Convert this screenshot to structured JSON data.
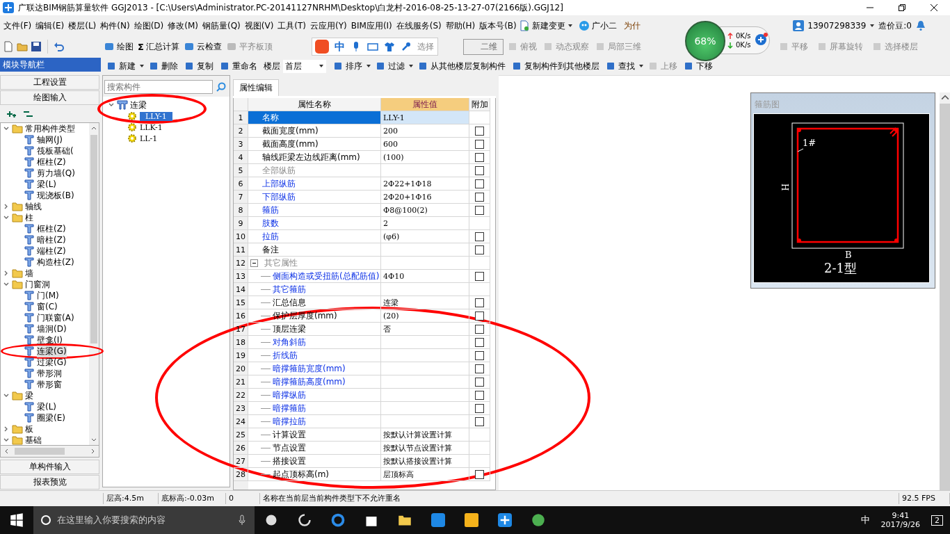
{
  "window": {
    "title": "广联达BIM钢筋算量软件 GGJ2013 - [C:\\Users\\Administrator.PC-20141127NRHM\\Desktop\\白龙村-2016-08-25-13-27-07(2166版).GGJ12]"
  },
  "menu": [
    "文件(F)",
    "编辑(E)",
    "楼层(L)",
    "构件(N)",
    "绘图(D)",
    "修改(M)",
    "钢筋量(Q)",
    "视图(V)",
    "工具(T)",
    "云应用(Y)",
    "BIM应用(I)",
    "在线服务(S)",
    "帮助(H)",
    "版本号(B)"
  ],
  "menu_extras": {
    "change": "新建变更",
    "assistant": "广小二",
    "notice": "为什",
    "account": "13907298339",
    "beans": "造价豆:0"
  },
  "toolbar": [
    {
      "label": "绘图",
      "disabled": false
    },
    {
      "label": "汇总计算",
      "glyph": "Σ",
      "disabled": false
    },
    {
      "label": "云检查",
      "disabled": false
    },
    {
      "label": "平齐板顶",
      "disabled": true
    }
  ],
  "ime": {
    "label": "中",
    "tail": "选择"
  },
  "view_toolbar": [
    {
      "label": "二维",
      "kind": "select"
    },
    {
      "label": "俯视",
      "kind": "button"
    },
    {
      "label": "动态观察",
      "kind": "button"
    },
    {
      "label": "局部三维",
      "kind": "button"
    },
    {
      "label": "平移",
      "kind": "button"
    },
    {
      "label": "屏幕旋转",
      "kind": "button"
    },
    {
      "label": "选择楼层",
      "kind": "button"
    }
  ],
  "net_widget": {
    "percent": "68%",
    "up": "0K/s",
    "down": "0K/s"
  },
  "nav": {
    "title": "模块导航栏",
    "top_buttons": [
      "工程设置",
      "绘图输入"
    ],
    "tree": [
      {
        "label": "常用构件类型",
        "expanded": true,
        "children": [
          {
            "label": "轴网(J)",
            "selected": false
          },
          {
            "label": "筏板基础(",
            "selected": false
          },
          {
            "label": "框柱(Z)",
            "selected": false
          },
          {
            "label": "剪力墙(Q)",
            "selected": false
          },
          {
            "label": "梁(L)",
            "selected": false
          },
          {
            "label": "现浇板(B)",
            "selected": false
          }
        ]
      },
      {
        "label": "轴线",
        "expanded": false
      },
      {
        "label": "柱",
        "expanded": true,
        "children": [
          {
            "label": "框柱(Z)",
            "selected": false
          },
          {
            "label": "暗柱(Z)",
            "selected": false
          },
          {
            "label": "端柱(Z)",
            "selected": false
          },
          {
            "label": "构造柱(Z)",
            "selected": false
          }
        ]
      },
      {
        "label": "墙",
        "expanded": false
      },
      {
        "label": "门窗洞",
        "expanded": true,
        "children": [
          {
            "label": "门(M)",
            "selected": false
          },
          {
            "label": "窗(C)",
            "selected": false
          },
          {
            "label": "门联窗(A)",
            "selected": false
          },
          {
            "label": "墙洞(D)",
            "selected": false
          },
          {
            "label": "壁龛(I)",
            "selected": false
          },
          {
            "label": "连梁(G)",
            "selected": true
          },
          {
            "label": "过梁(G)",
            "selected": false
          },
          {
            "label": "带形洞",
            "selected": false
          },
          {
            "label": "带形窗",
            "selected": false
          }
        ]
      },
      {
        "label": "梁",
        "expanded": true,
        "children": [
          {
            "label": "梁(L)",
            "selected": false
          },
          {
            "label": "圈梁(E)",
            "selected": false
          }
        ]
      },
      {
        "label": "板",
        "expanded": false
      },
      {
        "label": "基础",
        "expanded": true
      }
    ],
    "bottom_buttons": [
      "单构件输入",
      "报表预览"
    ]
  },
  "list_toolbar": [
    {
      "label": "新建",
      "kind": "button",
      "dropdown": true,
      "disabled": false
    },
    {
      "label": "删除",
      "kind": "button",
      "dropdown": false,
      "disabled": false
    },
    {
      "label": "复制",
      "kind": "button",
      "dropdown": false,
      "disabled": false
    },
    {
      "label": "重命名",
      "kind": "button",
      "dropdown": false,
      "disabled": false
    },
    {
      "label": "楼层",
      "kind": "select",
      "value": "首层"
    },
    {
      "label": "排序",
      "kind": "button",
      "dropdown": true,
      "disabled": false
    },
    {
      "label": "过滤",
      "kind": "button",
      "dropdown": true,
      "disabled": false
    },
    {
      "label": "从其他楼层复制构件",
      "kind": "button",
      "dropdown": false,
      "disabled": false
    },
    {
      "label": "复制构件到其他楼层",
      "kind": "button",
      "dropdown": false,
      "disabled": false
    },
    {
      "label": "查找",
      "kind": "button",
      "dropdown": true,
      "disabled": false
    },
    {
      "label": "上移",
      "kind": "button",
      "dropdown": false,
      "disabled": true
    },
    {
      "label": "下移",
      "kind": "button",
      "dropdown": false,
      "disabled": false
    }
  ],
  "component_list": {
    "placeholder": "搜索构件",
    "root": {
      "label": "连梁",
      "expanded": true,
      "children": [
        {
          "label": "LLY-1",
          "selected": true
        },
        {
          "label": "LLK-1",
          "selected": false
        },
        {
          "label": "LL-1",
          "selected": false
        }
      ]
    }
  },
  "properties": {
    "tab": "属性编辑",
    "columns": [
      "属性名称",
      "属性值",
      "附加"
    ],
    "rows": [
      {
        "no": "1",
        "name": "名称",
        "value": "LLY-1",
        "kind": "normal",
        "selected": true
      },
      {
        "no": "2",
        "name": "截面宽度(mm)",
        "value": "200",
        "kind": "normal",
        "selected": false,
        "checked": false
      },
      {
        "no": "3",
        "name": "截面高度(mm)",
        "value": "600",
        "kind": "normal",
        "selected": false,
        "checked": false
      },
      {
        "no": "4",
        "name": "轴线距梁左边线距离(mm)",
        "value": "(100)",
        "kind": "normal",
        "selected": false,
        "checked": false
      },
      {
        "no": "5",
        "name": "全部纵筋",
        "kind": "muted",
        "selected": false,
        "checked": false
      },
      {
        "no": "6",
        "name": "上部纵筋",
        "value": "2Ф22+1Ф18",
        "kind": "link",
        "selected": false,
        "checked": false
      },
      {
        "no": "7",
        "name": "下部纵筋",
        "value": "2Ф20+1Ф16",
        "kind": "link",
        "selected": false,
        "checked": false
      },
      {
        "no": "8",
        "name": "箍筋",
        "value": "Ф8@100(2)",
        "kind": "link",
        "selected": false,
        "checked": false
      },
      {
        "no": "9",
        "name": "肢数",
        "value": "2",
        "kind": "link",
        "selected": false
      },
      {
        "no": "10",
        "name": "拉筋",
        "value": "(φ6)",
        "kind": "link",
        "selected": false,
        "checked": false
      },
      {
        "no": "11",
        "name": "备注",
        "kind": "normal",
        "selected": false,
        "checked": false
      },
      {
        "no": "12",
        "name": "其它属性",
        "kind": "muted",
        "selected": false,
        "expanded": true,
        "children": [
          {
            "no": "13",
            "name": "侧面构造或受扭筋(总配筋值)",
            "value": "4Ф10",
            "kind": "link",
            "selected": false,
            "checked": false
          },
          {
            "no": "14",
            "name": "其它箍筋",
            "kind": "link",
            "selected": false
          },
          {
            "no": "15",
            "name": "汇总信息",
            "value": "连梁",
            "kind": "normal",
            "selected": false,
            "checked": false
          },
          {
            "no": "16",
            "name": "保护层厚度(mm)",
            "value": "(20)",
            "kind": "normal",
            "selected": false,
            "checked": false
          },
          {
            "no": "17",
            "name": "顶层连梁",
            "value": "否",
            "kind": "normal",
            "selected": false,
            "checked": false
          },
          {
            "no": "18",
            "name": "对角斜筋",
            "kind": "link",
            "selected": false,
            "checked": false
          },
          {
            "no": "19",
            "name": "折线筋",
            "kind": "link",
            "selected": false,
            "checked": false
          },
          {
            "no": "20",
            "name": "暗撑箍筋宽度(mm)",
            "kind": "link",
            "selected": false,
            "checked": false
          },
          {
            "no": "21",
            "name": "暗撑箍筋高度(mm)",
            "kind": "link",
            "selected": false,
            "checked": false
          },
          {
            "no": "22",
            "name": "暗撑纵筋",
            "kind": "link",
            "selected": false,
            "checked": false
          },
          {
            "no": "23",
            "name": "暗撑箍筋",
            "kind": "link",
            "selected": false,
            "checked": false
          },
          {
            "no": "24",
            "name": "暗撑拉筋",
            "kind": "link",
            "selected": false,
            "checked": false
          },
          {
            "no": "25",
            "name": "计算设置",
            "value": "按默认计算设置计算",
            "kind": "normal",
            "selected": false
          },
          {
            "no": "26",
            "name": "节点设置",
            "value": "按默认节点设置计算",
            "kind": "normal",
            "selected": false
          },
          {
            "no": "27",
            "name": "搭接设置",
            "value": "按默认搭接设置计算",
            "kind": "normal",
            "selected": false
          },
          {
            "no": "28",
            "name": "起点顶标高(m)",
            "value": "层顶标高",
            "kind": "normal",
            "selected": false,
            "checked": false
          }
        ]
      }
    ]
  },
  "stirrup_view": {
    "title": "箍筋图",
    "bar_label": "1#",
    "height_label": "H",
    "width_label": "B",
    "type_label": "2-1型"
  },
  "status_bar": [
    "层高:4.5m",
    "底标高:-0.03m",
    "0",
    "名称在当前层当前构件类型下不允许重名",
    "92.5 FPS"
  ],
  "taskbar": {
    "search_placeholder": "在这里输入你要搜索的内容",
    "ime": "中",
    "time": "9:41",
    "date": "2017/9/26",
    "notifications": "2"
  }
}
